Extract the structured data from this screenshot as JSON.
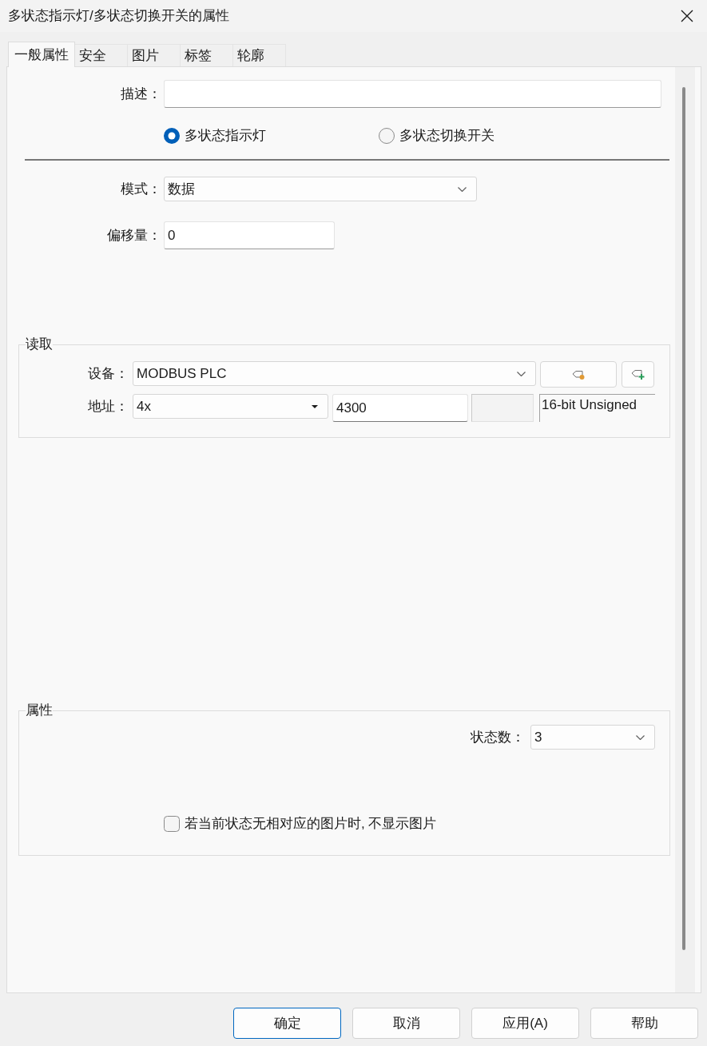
{
  "window": {
    "title": "多状态指示灯/多状态切换开关的属性"
  },
  "tabs": [
    {
      "label": "一般属性",
      "selected": true
    },
    {
      "label": "安全",
      "selected": false
    },
    {
      "label": "图片",
      "selected": false
    },
    {
      "label": "标签",
      "selected": false
    },
    {
      "label": "轮廓",
      "selected": false
    }
  ],
  "general": {
    "description": {
      "label": "描述："
    },
    "object_type": [
      {
        "label": "多状态指示灯",
        "selected": true
      },
      {
        "label": "多状态切换开关",
        "selected": false
      }
    ],
    "mode": {
      "label": "模式：",
      "value": "数据"
    },
    "offset": {
      "label": "偏移量：",
      "value": "0"
    }
  },
  "read": {
    "title": "读取",
    "device": {
      "label": "设备：",
      "value": "MODBUS PLC"
    },
    "address": {
      "label": "地址：",
      "type": "4x",
      "value": "4300",
      "data_type": "16-bit Unsigned"
    }
  },
  "attributes": {
    "title": "属性",
    "state_count": {
      "label": "状态数：",
      "value": "3"
    },
    "hide_missing_image": {
      "label": "若当前状态无相对应的图片时, 不显示图片",
      "checked": false
    }
  },
  "buttons": [
    {
      "label": "确定",
      "focused": true
    },
    {
      "label": "取消",
      "focused": false
    },
    {
      "label": "应用(A)",
      "focused": false
    },
    {
      "label": "帮助",
      "focused": false
    }
  ]
}
